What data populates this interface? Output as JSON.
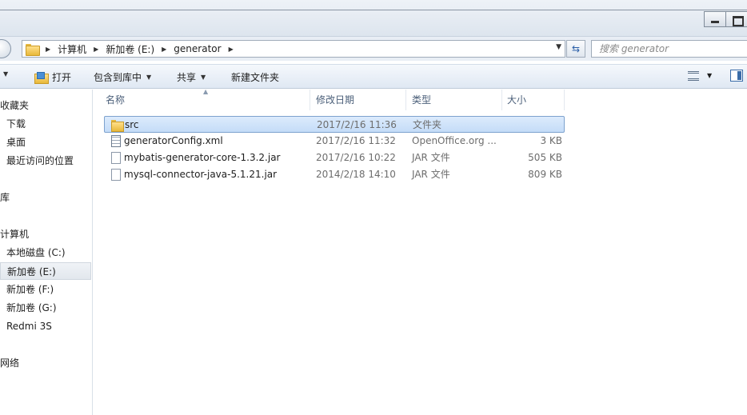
{
  "address": {
    "crumbs": [
      "计算机",
      "新加卷 (E:)",
      "generator"
    ],
    "search_placeholder": "搜索 generator"
  },
  "toolbar": {
    "open": "打开",
    "include_in_library": "包含到库中",
    "share": "共享",
    "new_folder": "新建文件夹"
  },
  "nav": {
    "favorites": "收藏夹",
    "downloads": "下载",
    "desktop": "桌面",
    "recent": "最近访问的位置",
    "libraries": "库",
    "computer": "计算机",
    "drive_c": "本地磁盘 (C:)",
    "drive_e": "新加卷 (E:)",
    "drive_f": "新加卷 (F:)",
    "drive_g": "新加卷 (G:)",
    "phone": "Redmi 3S",
    "network": "网络"
  },
  "columns": {
    "name": "名称",
    "date": "修改日期",
    "type": "类型",
    "size": "大小"
  },
  "files": [
    {
      "name": "src",
      "date": "2017/2/16 11:36",
      "type": "文件夹",
      "size": "",
      "icon": "folder-icon"
    },
    {
      "name": "generatorConfig.xml",
      "date": "2017/2/16 11:32",
      "type": "OpenOffice.org ...",
      "size": "3 KB",
      "icon": "spreadsheet-file-icon"
    },
    {
      "name": "mybatis-generator-core-1.3.2.jar",
      "date": "2017/2/16 10:22",
      "type": "JAR 文件",
      "size": "505 KB",
      "icon": "file-icon"
    },
    {
      "name": "mysql-connector-java-5.1.21.jar",
      "date": "2014/2/18 14:10",
      "type": "JAR 文件",
      "size": "809 KB",
      "icon": "file-icon"
    }
  ]
}
